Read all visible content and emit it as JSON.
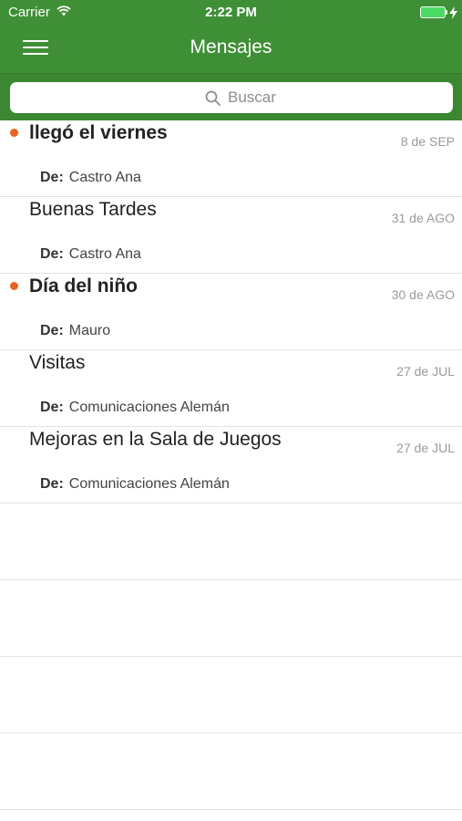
{
  "status_bar": {
    "carrier": "Carrier",
    "time": "2:22 PM",
    "wifi_icon": "wifi-icon",
    "battery_icon": "battery-icon",
    "charging_icon": "bolt-icon"
  },
  "nav": {
    "title": "Mensajes",
    "menu_icon": "hamburger-menu-icon"
  },
  "search": {
    "placeholder": "Buscar",
    "icon": "search-icon"
  },
  "colors": {
    "header_green": "#3f8f36",
    "unread_dot": "#e8651e",
    "battery": "#4cd964"
  },
  "messages": [
    {
      "subject": "llegó el viernes",
      "date": "8 de SEP",
      "from_label": "De:",
      "from": "Castro Ana",
      "unread": true
    },
    {
      "subject": "Buenas Tardes",
      "date": "31 de AGO",
      "from_label": "De:",
      "from": "Castro Ana",
      "unread": false
    },
    {
      "subject": "Día del niño",
      "date": "30 de AGO",
      "from_label": "De:",
      "from": "Mauro",
      "unread": true
    },
    {
      "subject": "Visitas",
      "date": "27 de JUL",
      "from_label": "De:",
      "from": "Comunicaciones Alemán",
      "unread": false
    },
    {
      "subject": "Mejoras en la Sala de Juegos",
      "date": "27 de JUL",
      "from_label": "De:",
      "from": "Comunicaciones Alemán",
      "unread": false
    }
  ]
}
